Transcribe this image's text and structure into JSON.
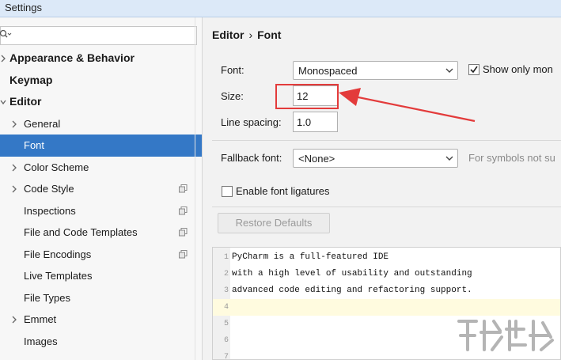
{
  "window": {
    "title": "Settings"
  },
  "sidebar": {
    "search": {
      "placeholder": ""
    },
    "items": [
      {
        "label": "Appearance & Behavior",
        "level": 0,
        "expand": "collapsed",
        "bold": true
      },
      {
        "label": "Keymap",
        "level": 0,
        "expand": "none",
        "bold": true
      },
      {
        "label": "Editor",
        "level": 0,
        "expand": "expanded",
        "bold": true
      },
      {
        "label": "General",
        "level": 1,
        "expand": "collapsed"
      },
      {
        "label": "Font",
        "level": 1,
        "expand": "none",
        "selected": true
      },
      {
        "label": "Color Scheme",
        "level": 1,
        "expand": "collapsed"
      },
      {
        "label": "Code Style",
        "level": 1,
        "expand": "collapsed",
        "project_icon": true
      },
      {
        "label": "Inspections",
        "level": 1,
        "expand": "none",
        "project_icon": true
      },
      {
        "label": "File and Code Templates",
        "level": 1,
        "expand": "none",
        "project_icon": true
      },
      {
        "label": "File Encodings",
        "level": 1,
        "expand": "none",
        "project_icon": true
      },
      {
        "label": "Live Templates",
        "level": 1,
        "expand": "none"
      },
      {
        "label": "File Types",
        "level": 1,
        "expand": "none"
      },
      {
        "label": "Emmet",
        "level": 1,
        "expand": "collapsed"
      },
      {
        "label": "Images",
        "level": 1,
        "expand": "none"
      }
    ]
  },
  "breadcrumb": {
    "parent": "Editor",
    "separator": "›",
    "current": "Font"
  },
  "font": {
    "font_label": "Font:",
    "font_value": "Monospaced",
    "show_mono_label": "Show only mon",
    "size_label": "Size:",
    "size_value": "12",
    "line_spacing_label": "Line spacing:",
    "line_spacing_value": "1.0",
    "fallback_label": "Fallback font:",
    "fallback_value": "<None>",
    "fallback_hint": "For symbols not su",
    "ligatures_label": "Enable font ligatures",
    "restore_label": "Restore Defaults"
  },
  "preview": {
    "lines": [
      {
        "num": "1",
        "text": "PyCharm is a full-featured IDE"
      },
      {
        "num": "2",
        "text": "with a high level of usability and outstanding"
      },
      {
        "num": "3",
        "text": "advanced code editing and refactoring support."
      },
      {
        "num": "4",
        "text": ""
      },
      {
        "num": "5",
        "text": ""
      },
      {
        "num": "6",
        "text": ""
      },
      {
        "num": "7",
        "text": ""
      }
    ]
  },
  "colors": {
    "selection": "#3478c6",
    "annotation_red": "#e33b3b",
    "titlebar": "#dce9f8"
  }
}
